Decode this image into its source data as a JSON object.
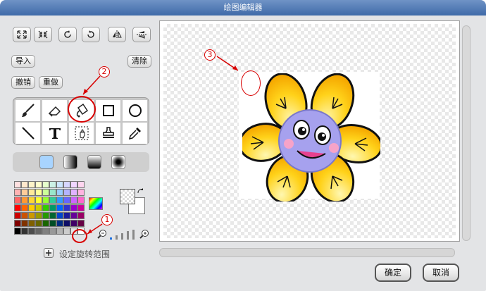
{
  "window": {
    "title": "绘图编辑器"
  },
  "left": {
    "import_label": "导入",
    "clear_label": "清除",
    "undo_label": "撤销",
    "redo_label": "重做",
    "rotation_center_label": "设定旋转范围"
  },
  "annotations": {
    "marker_1": "1",
    "marker_2": "2",
    "marker_3": "3"
  },
  "footer": {
    "ok_label": "确定",
    "cancel_label": "取消"
  },
  "colors": {
    "accent": "#d80000",
    "primary_color": "#1a1a1a",
    "secondary_color": "#ffffff"
  },
  "palette": [
    [
      "#ffe0e0",
      "#ffe8cc",
      "#fff4c8",
      "#ffffcc",
      "#e6ffcc",
      "#ccf2e6",
      "#cce6ff",
      "#d6d6ff",
      "#f0d6ff",
      "#ffd6f0"
    ],
    [
      "#ffb3b3",
      "#ffcc99",
      "#ffe999",
      "#ffff99",
      "#ccff99",
      "#99e6cc",
      "#99ccff",
      "#b3b3ff",
      "#e0b3ff",
      "#ffb3e0"
    ],
    [
      "#ff6666",
      "#ff9933",
      "#ffd633",
      "#ffff33",
      "#99ff33",
      "#33cc99",
      "#3399ff",
      "#6666ff",
      "#cc66ff",
      "#ff66cc"
    ],
    [
      "#ff0000",
      "#ff6600",
      "#ffcc00",
      "#cccc00",
      "#33cc00",
      "#009966",
      "#0066ff",
      "#3333cc",
      "#9900cc",
      "#cc0099"
    ],
    [
      "#cc0000",
      "#cc5200",
      "#cc9900",
      "#999900",
      "#269900",
      "#006633",
      "#0044cc",
      "#1a1a99",
      "#660099",
      "#990066"
    ],
    [
      "#800000",
      "#803300",
      "#806000",
      "#666600",
      "#1a6600",
      "#004d26",
      "#002b80",
      "#0d0d66",
      "#400066",
      "#660044"
    ],
    [
      "#000000",
      "#333333",
      "#4d4d4d",
      "#666666",
      "#808080",
      "#999999",
      "#b3b3b3",
      "#cccccc",
      "#e6e6e6",
      "#ffffff"
    ]
  ]
}
